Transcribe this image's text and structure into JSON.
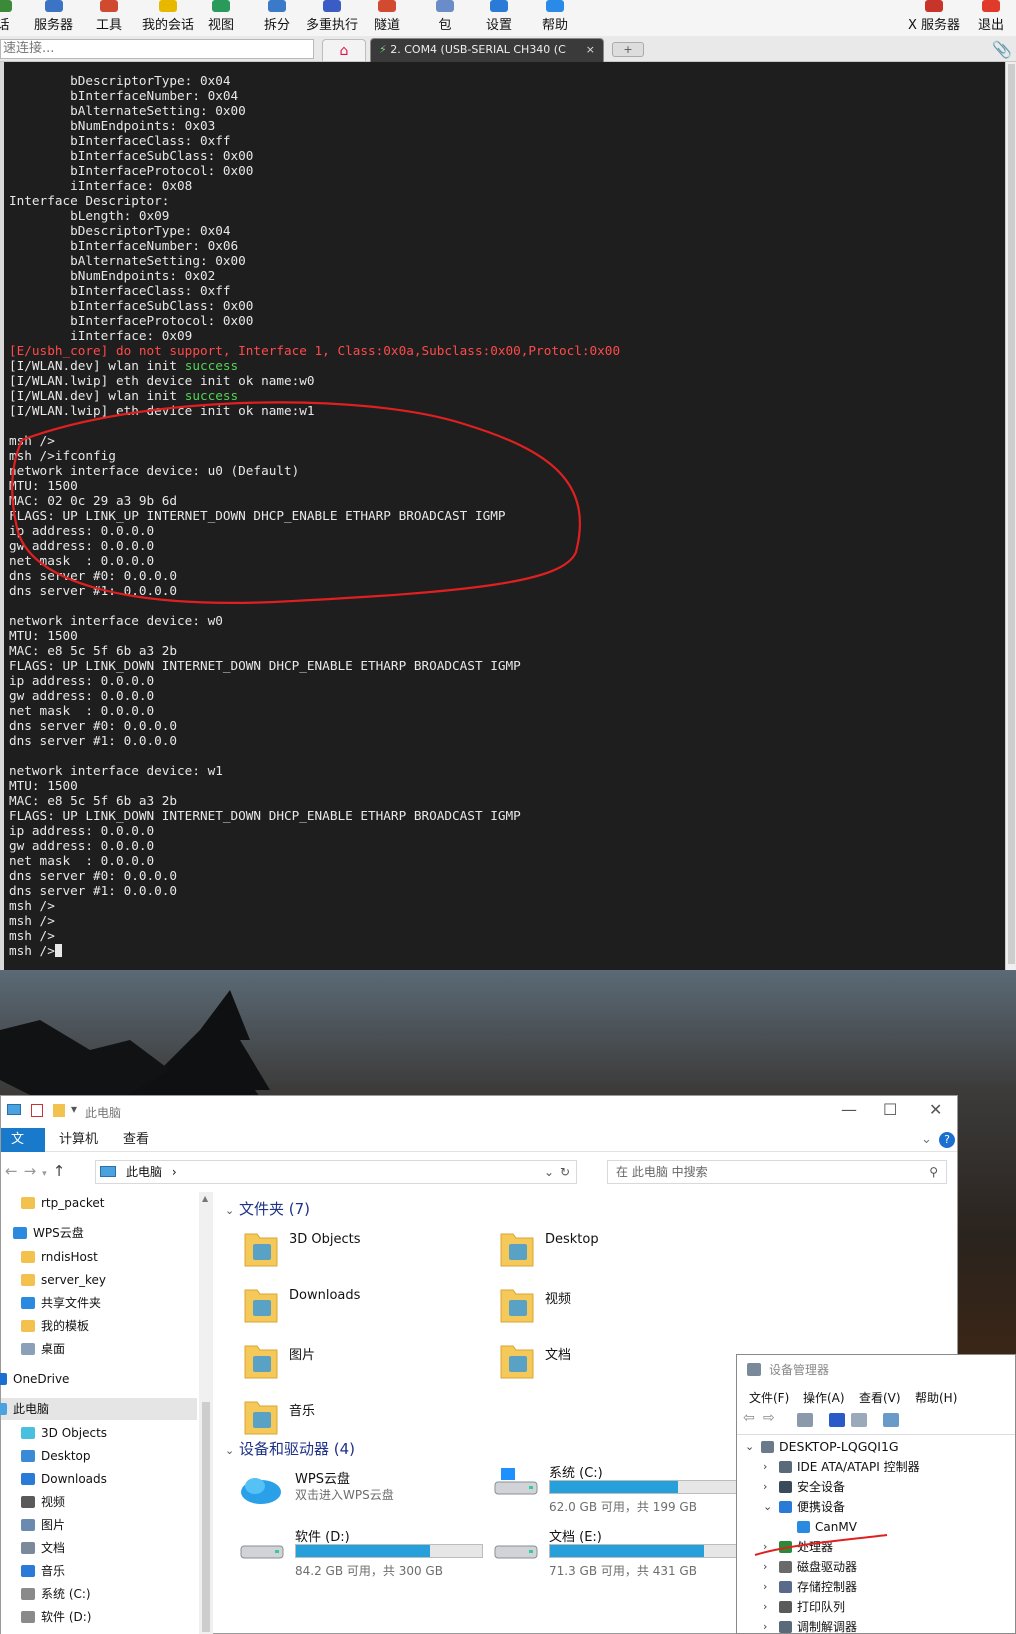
{
  "terminal_app": {
    "toolbar": [
      {
        "label": "话",
        "icon": "session-icon",
        "color": "#3a8a3a"
      },
      {
        "label": "服务器",
        "icon": "server-icon",
        "color": "#3b74c5"
      },
      {
        "label": "工具",
        "icon": "tools-icon",
        "color": "#d04a30"
      },
      {
        "label": "我的会话",
        "icon": "star-icon",
        "color": "#e8b800"
      },
      {
        "label": "视图",
        "icon": "view-icon",
        "color": "#2a9a5a"
      },
      {
        "label": "拆分",
        "icon": "split-icon",
        "color": "#3a7ac8"
      },
      {
        "label": "多重执行",
        "icon": "multiexec-icon",
        "color": "#3b5cc5"
      },
      {
        "label": "隧道",
        "icon": "tunnel-icon",
        "color": "#d24a30"
      },
      {
        "label": "包",
        "icon": "package-icon",
        "color": "#6a8cc8"
      },
      {
        "label": "设置",
        "icon": "settings-icon",
        "color": "#2a7ad8"
      },
      {
        "label": "帮助",
        "icon": "help-icon",
        "color": "#2a8ae8"
      }
    ],
    "toolbar_right": [
      {
        "label": "X 服务器",
        "icon": "x-server-icon",
        "color": "#c8342a"
      },
      {
        "label": "退出",
        "icon": "power-icon",
        "color": "#e03a2a"
      }
    ],
    "quick_connect_placeholder": "速连接...",
    "active_tab_label": "2. COM4  (USB-SERIAL CH340 (C",
    "close_glyph": "×",
    "lines": [
      {
        "text": "        bDescriptorType: 0x04"
      },
      {
        "text": "        bInterfaceNumber: 0x04"
      },
      {
        "text": "        bAlternateSetting: 0x00"
      },
      {
        "text": "        bNumEndpoints: 0x03"
      },
      {
        "text": "        bInterfaceClass: 0xff"
      },
      {
        "text": "        bInterfaceSubClass: 0x00"
      },
      {
        "text": "        bInterfaceProtocol: 0x00"
      },
      {
        "text": "        iInterface: 0x08"
      },
      {
        "text": "Interface Descriptor:"
      },
      {
        "text": "        bLength: 0x09"
      },
      {
        "text": "        bDescriptorType: 0x04"
      },
      {
        "text": "        bInterfaceNumber: 0x06"
      },
      {
        "text": "        bAlternateSetting: 0x00"
      },
      {
        "text": "        bNumEndpoints: 0x02"
      },
      {
        "text": "        bInterfaceClass: 0xff"
      },
      {
        "text": "        bInterfaceSubClass: 0x00"
      },
      {
        "text": "        bInterfaceProtocol: 0x00"
      },
      {
        "text": "        iInterface: 0x09"
      },
      {
        "text": "[E/usbh_core] do not support, Interface 1, Class:0x0a,Subclass:0x00,Protocl:0x00",
        "style": "red"
      },
      {
        "text": "[I/WLAN.dev] wlan init ",
        "tail": "success",
        "tail_style": "green"
      },
      {
        "text": "[I/WLAN.lwip] eth device init ok name:w0"
      },
      {
        "text": "[I/WLAN.dev] wlan init ",
        "tail": "success",
        "tail_style": "green"
      },
      {
        "text": "[I/WLAN.lwip] eth device init ok name:w1"
      },
      {
        "text": ""
      },
      {
        "text": "msh />"
      },
      {
        "text": "msh />ifconfig"
      },
      {
        "text": "network interface device: u0 (Default)"
      },
      {
        "text": "MTU: 1500"
      },
      {
        "text": "MAC: 02 0c 29 a3 9b 6d"
      },
      {
        "text": "FLAGS: UP LINK_UP INTERNET_DOWN DHCP_ENABLE ETHARP BROADCAST IGMP"
      },
      {
        "text": "ip address: 0.0.0.0"
      },
      {
        "text": "gw address: 0.0.0.0"
      },
      {
        "text": "net mask  : 0.0.0.0"
      },
      {
        "text": "dns server #0: 0.0.0.0"
      },
      {
        "text": "dns server #1: 0.0.0.0"
      },
      {
        "text": ""
      },
      {
        "text": "network interface device: w0"
      },
      {
        "text": "MTU: 1500"
      },
      {
        "text": "MAC: e8 5c 5f 6b a3 2b"
      },
      {
        "text": "FLAGS: UP LINK_DOWN INTERNET_DOWN DHCP_ENABLE ETHARP BROADCAST IGMP"
      },
      {
        "text": "ip address: 0.0.0.0"
      },
      {
        "text": "gw address: 0.0.0.0"
      },
      {
        "text": "net mask  : 0.0.0.0"
      },
      {
        "text": "dns server #0: 0.0.0.0"
      },
      {
        "text": "dns server #1: 0.0.0.0"
      },
      {
        "text": ""
      },
      {
        "text": "network interface device: w1"
      },
      {
        "text": "MTU: 1500"
      },
      {
        "text": "MAC: e8 5c 5f 6b a3 2b"
      },
      {
        "text": "FLAGS: UP LINK_DOWN INTERNET_DOWN DHCP_ENABLE ETHARP BROADCAST IGMP"
      },
      {
        "text": "ip address: 0.0.0.0"
      },
      {
        "text": "gw address: 0.0.0.0"
      },
      {
        "text": "net mask  : 0.0.0.0"
      },
      {
        "text": "dns server #0: 0.0.0.0"
      },
      {
        "text": "dns server #1: 0.0.0.0"
      },
      {
        "text": "msh />"
      },
      {
        "text": "msh />"
      },
      {
        "text": "msh />"
      },
      {
        "text": "msh />",
        "cursor": true
      }
    ],
    "colors": {
      "red": "#ff4a4a",
      "green": "#52d452",
      "annotation": "#e02020"
    }
  },
  "explorer": {
    "title": "此电脑",
    "ribbon_tabs": [
      "文件",
      "计算机",
      "查看"
    ],
    "breadcrumb": [
      "此电脑"
    ],
    "search_placeholder": "在 此电脑 中搜索",
    "nav": [
      {
        "label": "rtp_packet",
        "icon": "folder-icon",
        "color": "#f2c14e"
      },
      {
        "label": "WPS云盘",
        "icon": "cloud-icon",
        "color": "#2a8ae0"
      },
      {
        "label": "rndisHost",
        "icon": "folder-icon",
        "color": "#f2c14e"
      },
      {
        "label": "server_key",
        "icon": "folder-icon",
        "color": "#f2c14e"
      },
      {
        "label": "共享文件夹",
        "icon": "share-icon",
        "color": "#2a8ae0"
      },
      {
        "label": "我的模板",
        "icon": "folder-icon",
        "color": "#f2c14e"
      },
      {
        "label": "桌面",
        "icon": "desktop-icon",
        "color": "#8aa0b8"
      },
      {
        "label": "OneDrive",
        "icon": "onedrive-icon",
        "color": "#1a6fd0"
      },
      {
        "label": "此电脑",
        "icon": "computer-icon",
        "color": "#4aa3df",
        "selected": true
      },
      {
        "label": "3D Objects",
        "icon": "cube-icon",
        "color": "#4ac0e0"
      },
      {
        "label": "Desktop",
        "icon": "desktop-icon",
        "color": "#3a8ad8"
      },
      {
        "label": "Downloads",
        "icon": "download-icon",
        "color": "#2a7ad8"
      },
      {
        "label": "视频",
        "icon": "video-icon",
        "color": "#5a5a5a"
      },
      {
        "label": "图片",
        "icon": "picture-icon",
        "color": "#6a8ab0"
      },
      {
        "label": "文档",
        "icon": "document-icon",
        "color": "#7a8a9a"
      },
      {
        "label": "音乐",
        "icon": "music-icon",
        "color": "#2a7ad8"
      },
      {
        "label": "系统 (C:)",
        "icon": "drive-icon",
        "color": "#8a8a8a"
      },
      {
        "label": "软件 (D:)",
        "icon": "drive-icon",
        "color": "#8a8a8a"
      }
    ],
    "folders_header": "文件夹 (7)",
    "folders": [
      {
        "label": "3D Objects",
        "icon": "cube-folder-icon"
      },
      {
        "label": "Desktop",
        "icon": "desktop-folder-icon"
      },
      {
        "label": "Downloads",
        "icon": "downloads-folder-icon"
      },
      {
        "label": "视频",
        "icon": "video-folder-icon"
      },
      {
        "label": "图片",
        "icon": "pictures-folder-icon"
      },
      {
        "label": "文档",
        "icon": "documents-folder-icon"
      },
      {
        "label": "音乐",
        "icon": "music-folder-icon"
      }
    ],
    "drives_header": "设备和驱动器 (4)",
    "drives": [
      {
        "label": "WPS云盘",
        "sub": "双击进入WPS云盘",
        "icon": "wps-cloud-icon"
      },
      {
        "label": "系统 (C:)",
        "free": "62.0 GB 可用，共 199 GB",
        "used_fraction": 0.69,
        "icon": "windows-drive-icon"
      },
      {
        "label": "软件 (D:)",
        "free": "84.2 GB 可用，共 300 GB",
        "used_fraction": 0.72,
        "icon": "drive-icon"
      },
      {
        "label": "文档 (E:)",
        "free": "71.3 GB 可用，共 431 GB",
        "used_fraction": 0.83,
        "icon": "drive-icon"
      }
    ]
  },
  "device_manager": {
    "title": "设备管理器",
    "menu": [
      "文件(F)",
      "操作(A)",
      "查看(V)",
      "帮助(H)"
    ],
    "tree": [
      {
        "label": "DESKTOP-LQGQI1G",
        "icon": "computer-icon",
        "expanded": true,
        "color": "#6a7a8a"
      },
      {
        "label": "IDE ATA/ATAPI 控制器",
        "icon": "ide-icon",
        "color": "#5a6a7a"
      },
      {
        "label": "安全设备",
        "icon": "security-icon",
        "color": "#3a4a5a"
      },
      {
        "label": "便携设备",
        "icon": "portable-icon",
        "expanded": true,
        "color": "#2a7ad8"
      },
      {
        "label": "CanMV",
        "icon": "device-icon",
        "color": "#2a8ae0"
      },
      {
        "label": "处理器",
        "icon": "cpu-icon",
        "color": "#2a8a3a"
      },
      {
        "label": "磁盘驱动器",
        "icon": "disk-icon",
        "color": "#6a6a6a"
      },
      {
        "label": "存储控制器",
        "icon": "storage-icon",
        "color": "#5a6a8a"
      },
      {
        "label": "打印队列",
        "icon": "printer-icon",
        "color": "#5a5a5a"
      },
      {
        "label": "调制解调器",
        "icon": "modem-icon",
        "color": "#5a6a7a"
      }
    ]
  }
}
